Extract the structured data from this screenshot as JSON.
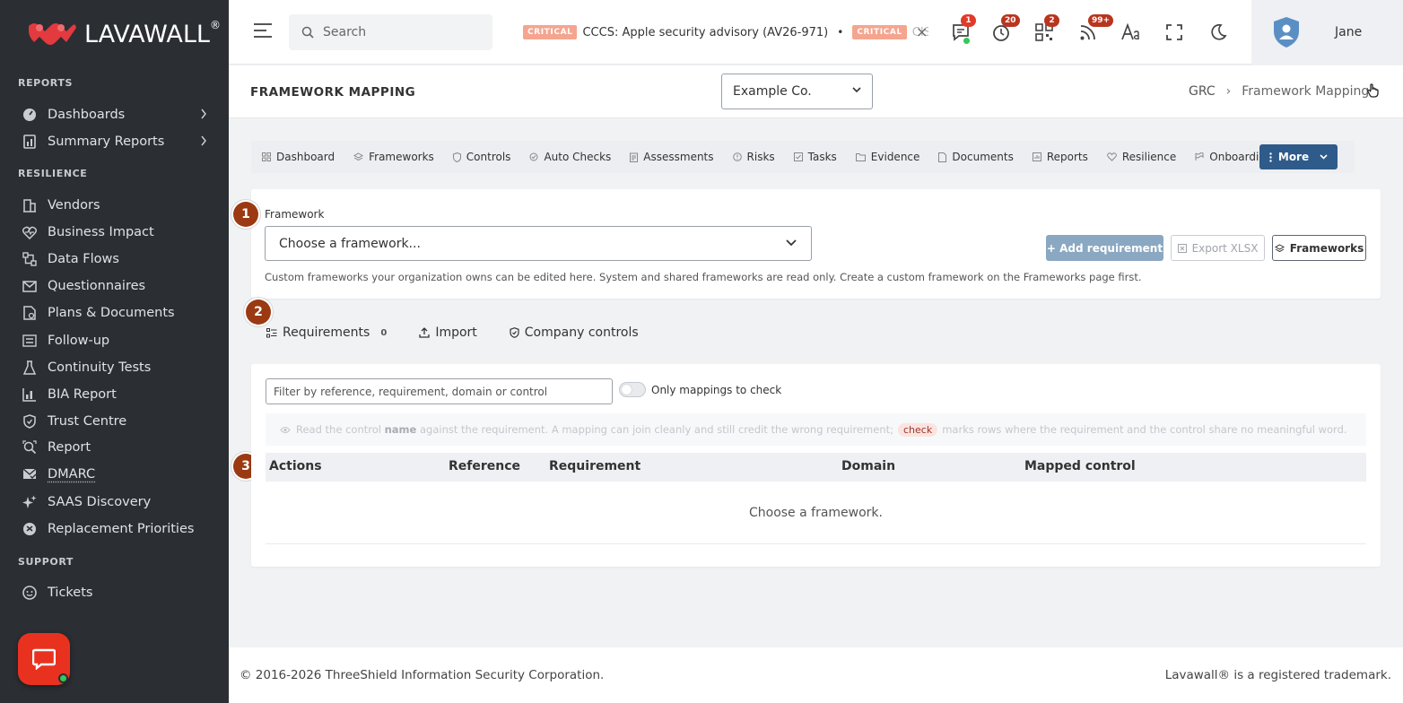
{
  "brand": {
    "name_a": "LAVA",
    "name_b": "WALL",
    "reg": "®"
  },
  "sidebar": {
    "sections": {
      "reports": "REPORTS",
      "resilience": "RESILIENCE",
      "support": "SUPPORT"
    },
    "reports_items": [
      {
        "label": "Dashboards",
        "icon": "dashboard-gauge-icon"
      },
      {
        "label": "Summary Reports",
        "icon": "summary-report-icon"
      }
    ],
    "resilience_items": [
      {
        "label": "Vendors",
        "icon": "building-icon"
      },
      {
        "label": "Business Impact",
        "icon": "heart-pulse-icon"
      },
      {
        "label": "Data Flows",
        "icon": "flow-icon"
      },
      {
        "label": "Questionnaires",
        "icon": "mail-icon"
      },
      {
        "label": "Plans & Documents",
        "icon": "document-icon"
      },
      {
        "label": "Follow-up",
        "icon": "list-check-icon"
      },
      {
        "label": "Continuity Tests",
        "icon": "flask-icon"
      },
      {
        "label": "BIA Report",
        "icon": "chart-bar-icon"
      },
      {
        "label": "Trust Centre",
        "icon": "shield-check-icon"
      },
      {
        "label": "Report",
        "icon": "magnify-report-icon"
      },
      {
        "label": "DMARC",
        "icon": "mail-check-icon"
      },
      {
        "label": "SAAS Discovery",
        "icon": "sparkles-icon"
      },
      {
        "label": "Replacement Priorities",
        "icon": "priority-icon"
      }
    ],
    "support_items": [
      {
        "label": "Tickets",
        "icon": "support-face-icon"
      }
    ]
  },
  "topbar": {
    "search_placeholder": "Search",
    "ticker": {
      "badge": "CRITICAL",
      "item1": "CCCS: Apple security advisory (AV26-971)",
      "sep": "•",
      "item2": "CIS",
      "close": "×"
    },
    "badges": {
      "messages": "1",
      "timer": "20",
      "qr": "2",
      "feed": "99+"
    },
    "user_name": "Jane"
  },
  "page": {
    "title": "FRAMEWORK MAPPING",
    "company": "Example Co.",
    "breadcrumb": [
      "GRC",
      "Framework Mapping"
    ],
    "breadcrumb_sep": "›"
  },
  "tabs": [
    {
      "label": "Dashboard",
      "icon": "grid-icon"
    },
    {
      "label": "Frameworks",
      "icon": "layers-icon"
    },
    {
      "label": "Controls",
      "icon": "shield-icon"
    },
    {
      "label": "Auto Checks",
      "icon": "auto-check-icon"
    },
    {
      "label": "Assessments",
      "icon": "clipboard-icon"
    },
    {
      "label": "Risks",
      "icon": "alert-circle-icon"
    },
    {
      "label": "Tasks",
      "icon": "checkbox-icon"
    },
    {
      "label": "Evidence",
      "icon": "folder-icon"
    },
    {
      "label": "Documents",
      "icon": "document-icon"
    },
    {
      "label": "Reports",
      "icon": "report-icon"
    },
    {
      "label": "Resilience",
      "icon": "heart-icon"
    },
    {
      "label": "Onboarding",
      "icon": "onboarding-icon"
    }
  ],
  "more_label": "More",
  "framework_card": {
    "label": "Framework",
    "select_value": "Choose a framework...",
    "help": "Custom frameworks your organization owns can be edited here. System and shared frameworks are read only. Create a custom framework on the Frameworks page first.",
    "add_requirement": "+ Add requirement",
    "export": "Export XLSX",
    "frameworks": "Frameworks"
  },
  "steps": [
    "1",
    "2",
    "3"
  ],
  "subtabs": {
    "requirements": "Requirements",
    "requirements_count": "0",
    "import": "Import",
    "company_controls": "Company controls"
  },
  "mapping_card": {
    "filter_placeholder": "Filter by reference, requirement, domain or control",
    "toggle_label": "Only mappings to check",
    "hint_a": "Read the control ",
    "hint_b": "name",
    "hint_c": " against the requirement. A mapping can join cleanly and still credit the wrong requirement;",
    "hint_check": "check",
    "hint_d": "marks rows where the requirement and the control share no meaningful word.",
    "columns": [
      "Actions",
      "Reference",
      "Requirement",
      "Domain",
      "Mapped control"
    ],
    "empty": "Choose a framework."
  },
  "footer": {
    "left": "© 2016-2026 ThreeShield Information Security Corporation.",
    "right": "Lavawall® is a registered trademark."
  },
  "colors": {
    "sidebar_bg": "#2b2e33",
    "primary": "#2f5b8a",
    "step": "#9b3a12",
    "chat": "#e8321f",
    "critical": "#f5a58f"
  }
}
